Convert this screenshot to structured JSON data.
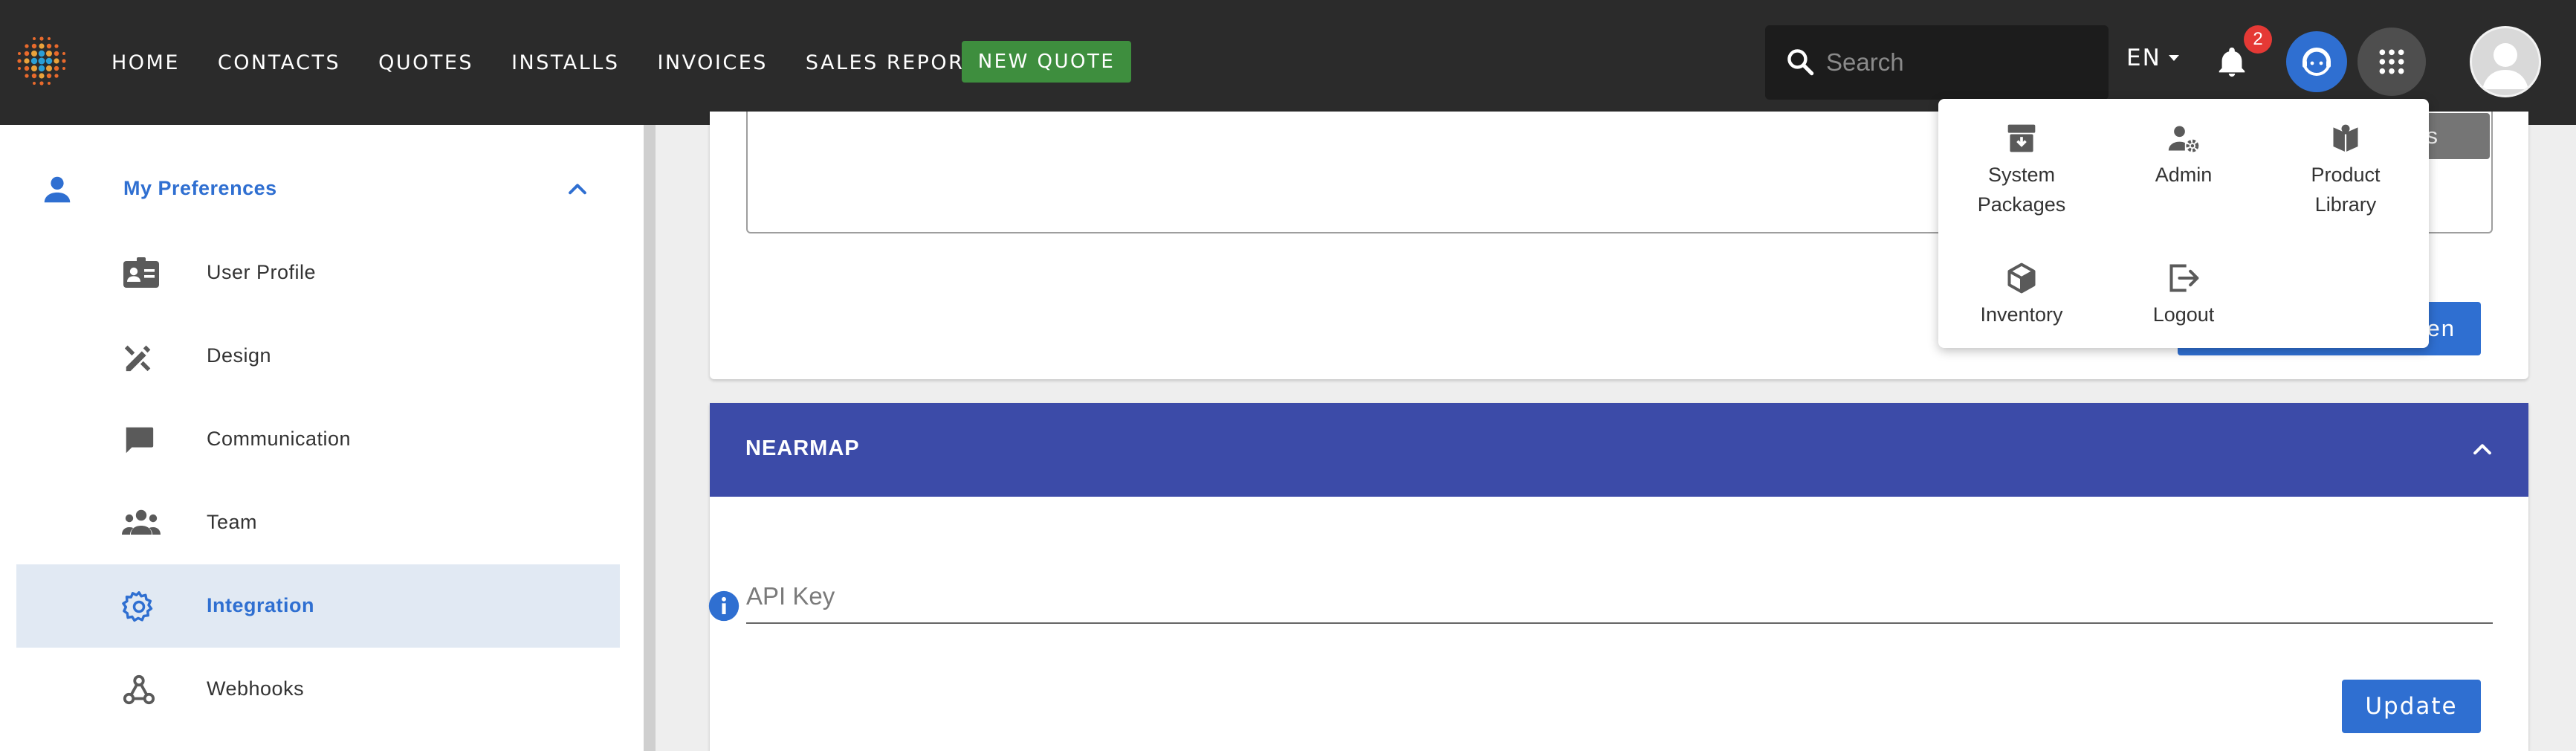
{
  "nav": {
    "items": [
      "HOME",
      "CONTACTS",
      "QUOTES",
      "INSTALLS",
      "INVOICES",
      "SALES REPORTS"
    ],
    "new_quote": "NEW QUOTE"
  },
  "search": {
    "placeholder": "Search"
  },
  "language": "EN",
  "notifications": {
    "count": "2"
  },
  "sidebar": {
    "section_label": "My Preferences",
    "items": [
      {
        "label": "User Profile",
        "icon": "id-card-icon"
      },
      {
        "label": "Design",
        "icon": "design-tools-icon"
      },
      {
        "label": "Communication",
        "icon": "chat-icon"
      },
      {
        "label": "Team",
        "icon": "team-icon"
      },
      {
        "label": "Integration",
        "icon": "gear-icon",
        "active": true
      },
      {
        "label": "Webhooks",
        "icon": "webhook-icon"
      }
    ]
  },
  "main": {
    "settings_tag": "ngs",
    "partial_button": "en",
    "nearmap": {
      "title": "NEARMAP",
      "api_key_label": "API Key",
      "update_label": "Update"
    }
  },
  "apps_menu": {
    "items": [
      {
        "label_line1": "System",
        "label_line2": "Packages",
        "icon": "archive-box-icon"
      },
      {
        "label_line1": "Admin",
        "label_line2": "",
        "icon": "user-gear-icon"
      },
      {
        "label_line1": "Product",
        "label_line2": "Library",
        "icon": "book-icon"
      },
      {
        "label_line1": "Inventory",
        "label_line2": "",
        "icon": "cube-icon"
      },
      {
        "label_line1": "Logout",
        "label_line2": "",
        "icon": "logout-icon"
      }
    ]
  },
  "colors": {
    "topbar": "#2b2b2b",
    "accent_blue": "#2f6fd1",
    "nearmap_header": "#3c4ba8",
    "new_quote_green": "#3e8e3e",
    "badge_red": "#e53935",
    "active_row": "#e1e9f3"
  }
}
